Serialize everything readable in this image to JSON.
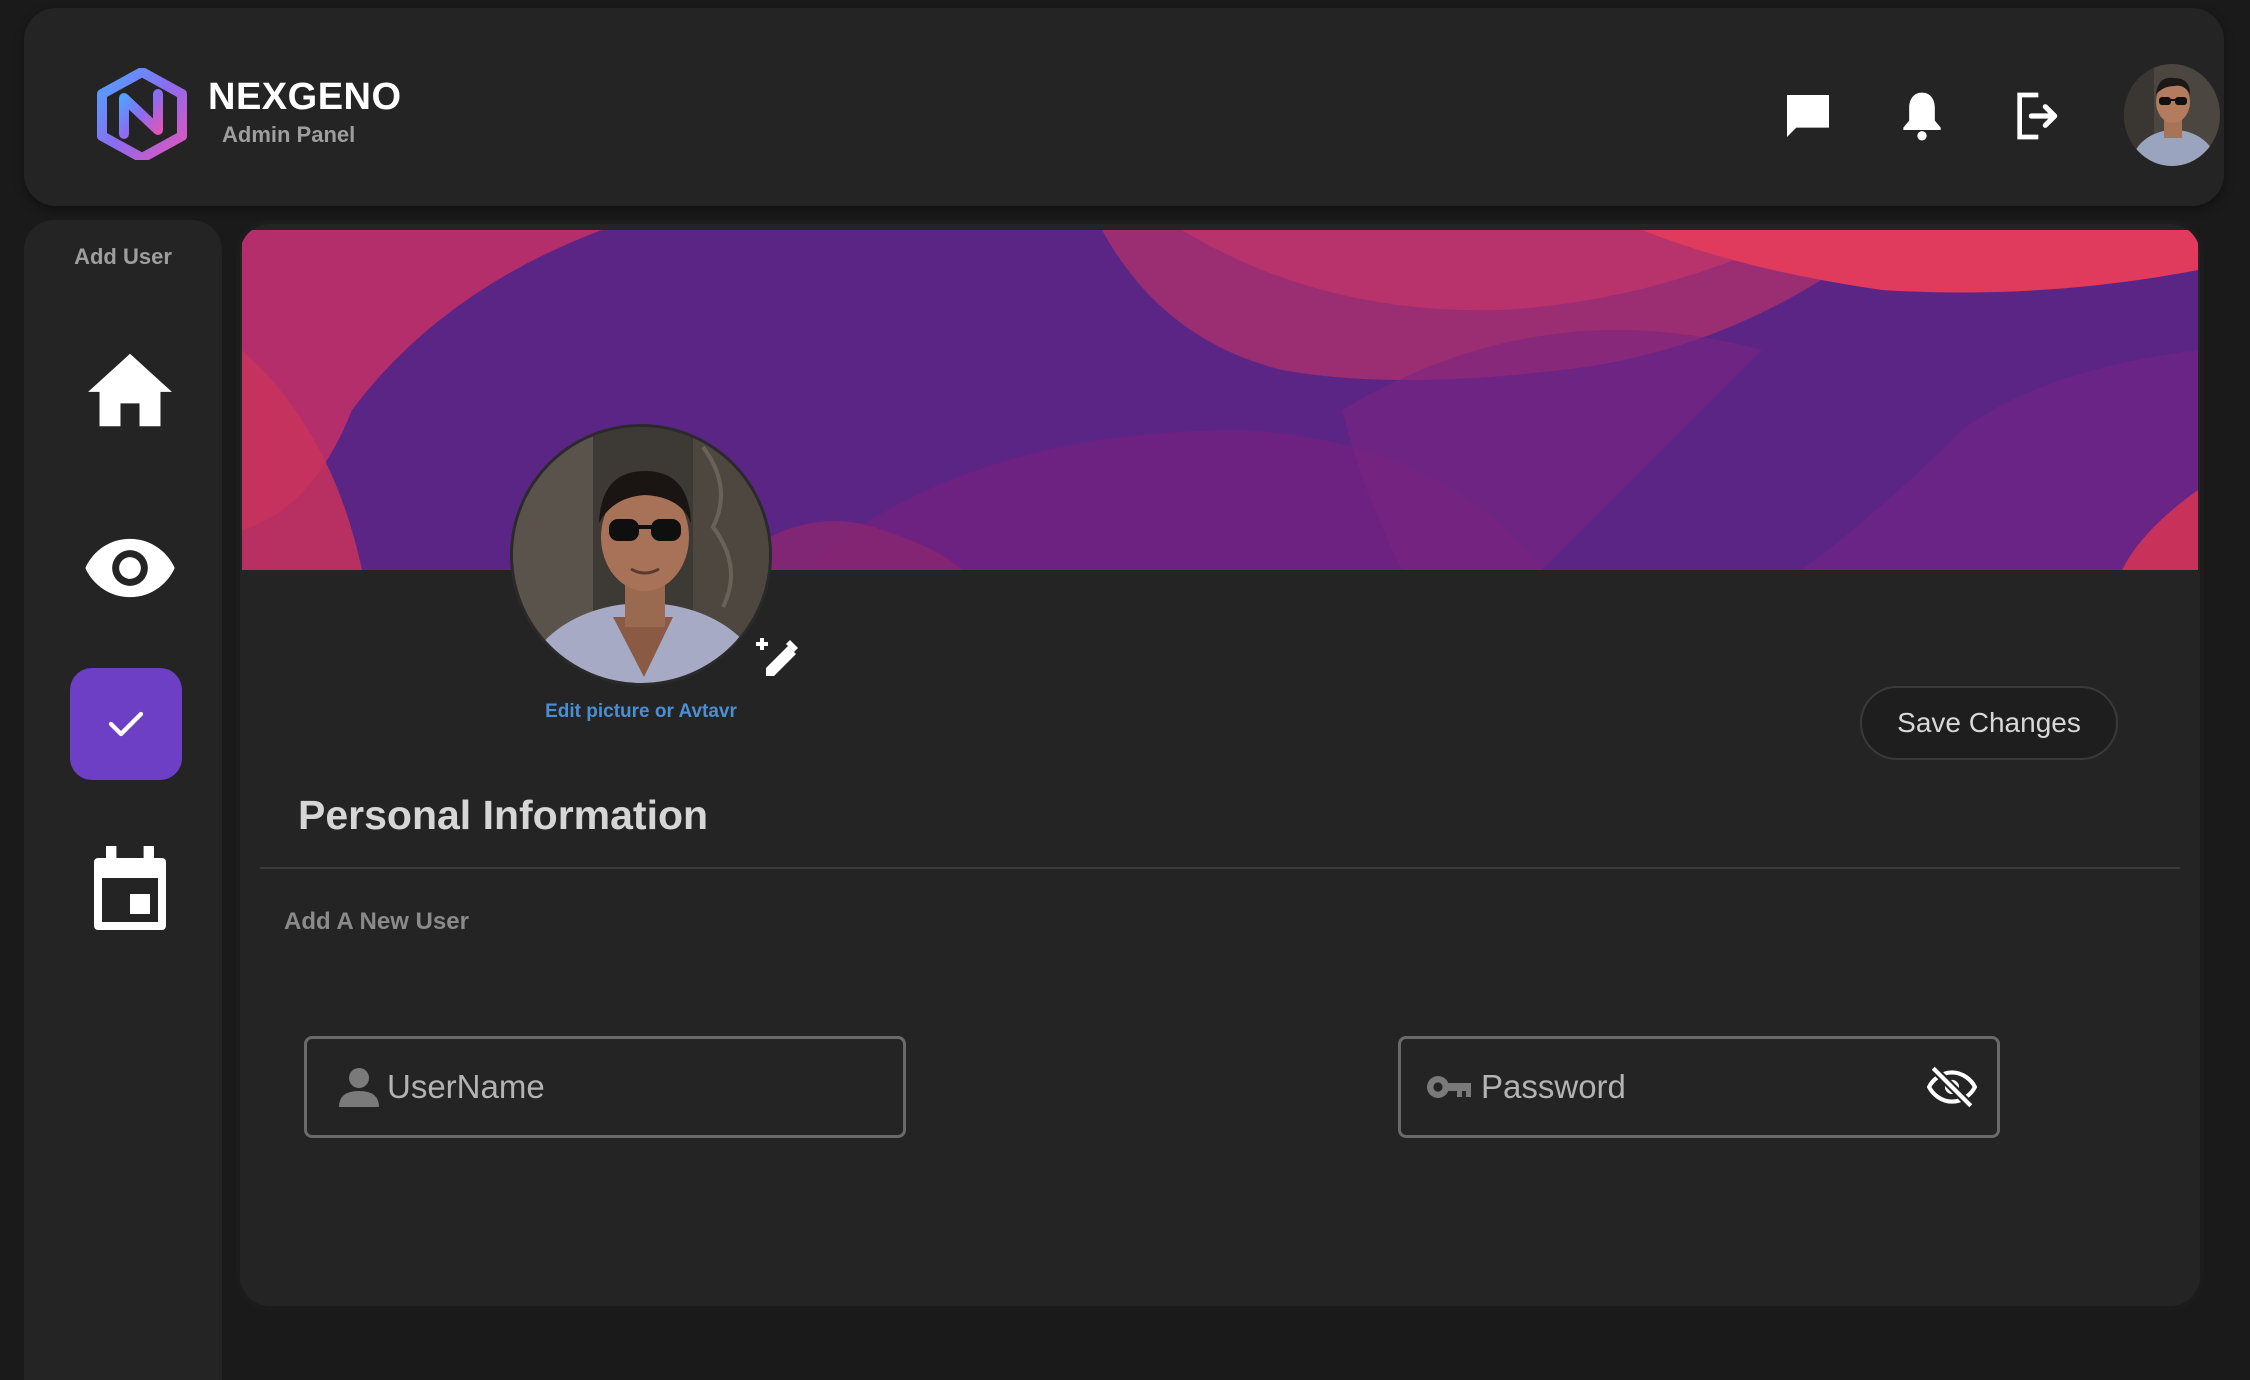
{
  "header": {
    "brand_name": "NEXGENO",
    "brand_subtitle": "Admin Panel",
    "icons": [
      "chat-icon",
      "bell-icon",
      "logout-icon"
    ]
  },
  "sidebar": {
    "title": "Add User",
    "items": [
      {
        "icon": "home-icon",
        "active": false
      },
      {
        "icon": "eye-icon",
        "active": false
      },
      {
        "icon": "check-icon",
        "active": true
      },
      {
        "icon": "calendar-icon",
        "active": false
      }
    ]
  },
  "profile": {
    "edit_label": "Edit picture or Avtavr",
    "save_label": "Save Changes"
  },
  "form": {
    "section_title": "Personal Information",
    "subtitle": "Add A New User",
    "username_placeholder": "UserName",
    "password_placeholder": "Password"
  },
  "colors": {
    "accent": "#6c3fc4",
    "card_bg": "#242424",
    "page_bg": "#1a1a1a",
    "link": "#4a8fd4",
    "banner_purple": "#5b2585",
    "banner_pink": "#c8325a"
  }
}
